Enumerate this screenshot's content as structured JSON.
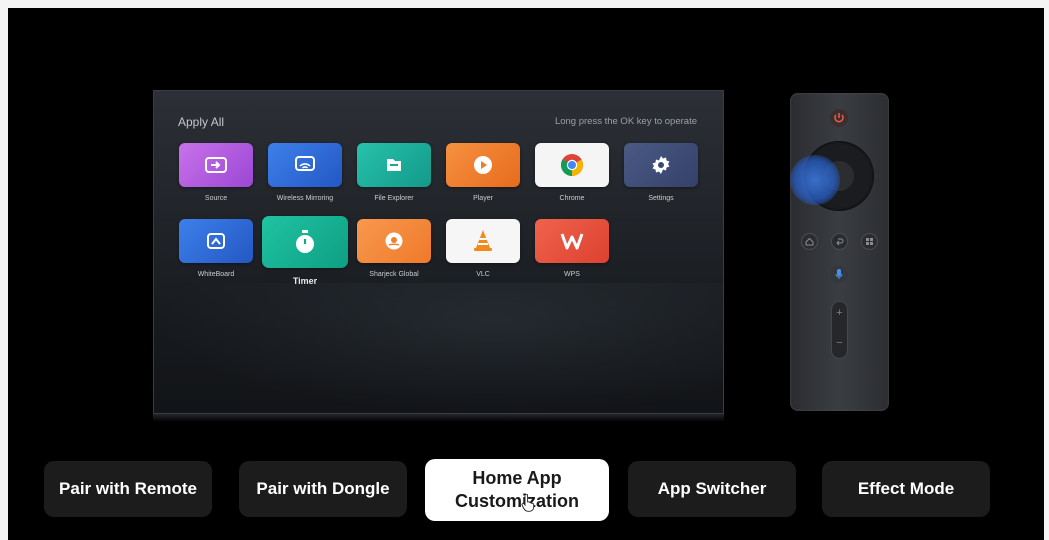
{
  "tv": {
    "title": "Apply All",
    "hint": "Long press the OK key to operate",
    "apps_row1": [
      {
        "label": "Source",
        "icon": "source-icon",
        "color": "#b65de0"
      },
      {
        "label": "Wireless Mirroring",
        "icon": "cast-icon",
        "color": "#2f6fd8"
      },
      {
        "label": "File Explorer",
        "icon": "folder-icon",
        "color": "#1fb39c"
      },
      {
        "label": "Player",
        "icon": "play-icon",
        "color": "#f07c2b"
      },
      {
        "label": "Chrome",
        "icon": "chrome-icon",
        "color": "#ffffff"
      },
      {
        "label": "Settings",
        "icon": "gear-icon",
        "color": "#3f4f78"
      }
    ],
    "apps_row2": [
      {
        "label": "WhiteBoard",
        "icon": "whiteboard-icon",
        "color": "#2f6fd8"
      },
      {
        "label": "Timer",
        "icon": "stopwatch-icon",
        "color": "#16b394",
        "focused": true
      },
      {
        "label": "Sharjeck Global",
        "icon": "globe-icon",
        "color": "#f4853a"
      },
      {
        "label": "VLC",
        "icon": "vlc-cone-icon",
        "color": "#ffffff"
      },
      {
        "label": "WPS",
        "icon": "wps-icon",
        "color": "#e9523f"
      }
    ]
  },
  "menu": {
    "items": [
      {
        "label": "Pair with Remote"
      },
      {
        "label": "Pair with Dongle"
      },
      {
        "label": "Home App Customization",
        "active": true
      },
      {
        "label": "App Switcher"
      },
      {
        "label": "Effect Mode"
      }
    ]
  },
  "colors": {
    "background": "#000000",
    "remote_highlight": "#2f6fd8",
    "active_button": "#ffffff",
    "inactive_button": "#1c1c1c"
  }
}
